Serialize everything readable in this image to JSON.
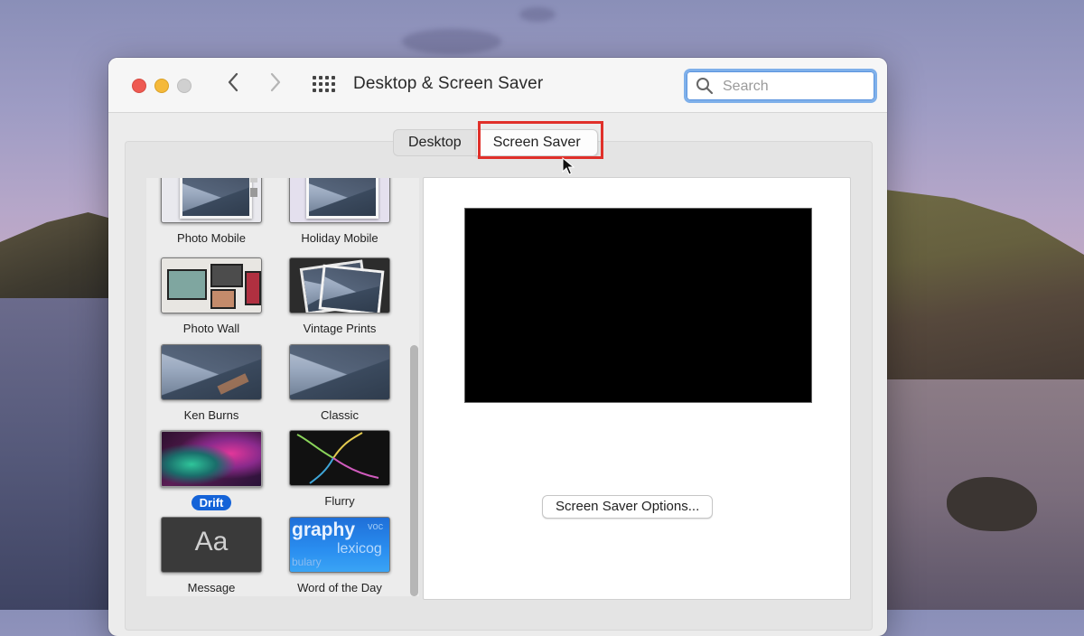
{
  "window": {
    "title": "Desktop & Screen Saver"
  },
  "toolbar": {
    "back_icon": "chevron-left-icon",
    "forward_icon": "chevron-right-icon",
    "grid_icon": "grid-icon"
  },
  "search": {
    "placeholder": "Search",
    "value": ""
  },
  "tabs": [
    {
      "label": "Desktop",
      "selected": false
    },
    {
      "label": "Screen Saver",
      "selected": true
    }
  ],
  "screen_savers": [
    {
      "label": "Photo Mobile"
    },
    {
      "label": "Holiday Mobile"
    },
    {
      "label": "Photo Wall"
    },
    {
      "label": "Vintage Prints"
    },
    {
      "label": "Ken Burns"
    },
    {
      "label": "Classic"
    },
    {
      "label": "Drift",
      "selected": true
    },
    {
      "label": "Flurry"
    },
    {
      "label": "Message",
      "thumb_text": "Aa"
    },
    {
      "label": "Word of the Day",
      "thumb_words": [
        "graphy",
        "voc",
        "lexicog",
        "bulary"
      ]
    }
  ],
  "preview": {
    "options_label": "Screen Saver Options..."
  },
  "colors": {
    "accent": "#1463d8",
    "highlight": "#e0302a"
  }
}
